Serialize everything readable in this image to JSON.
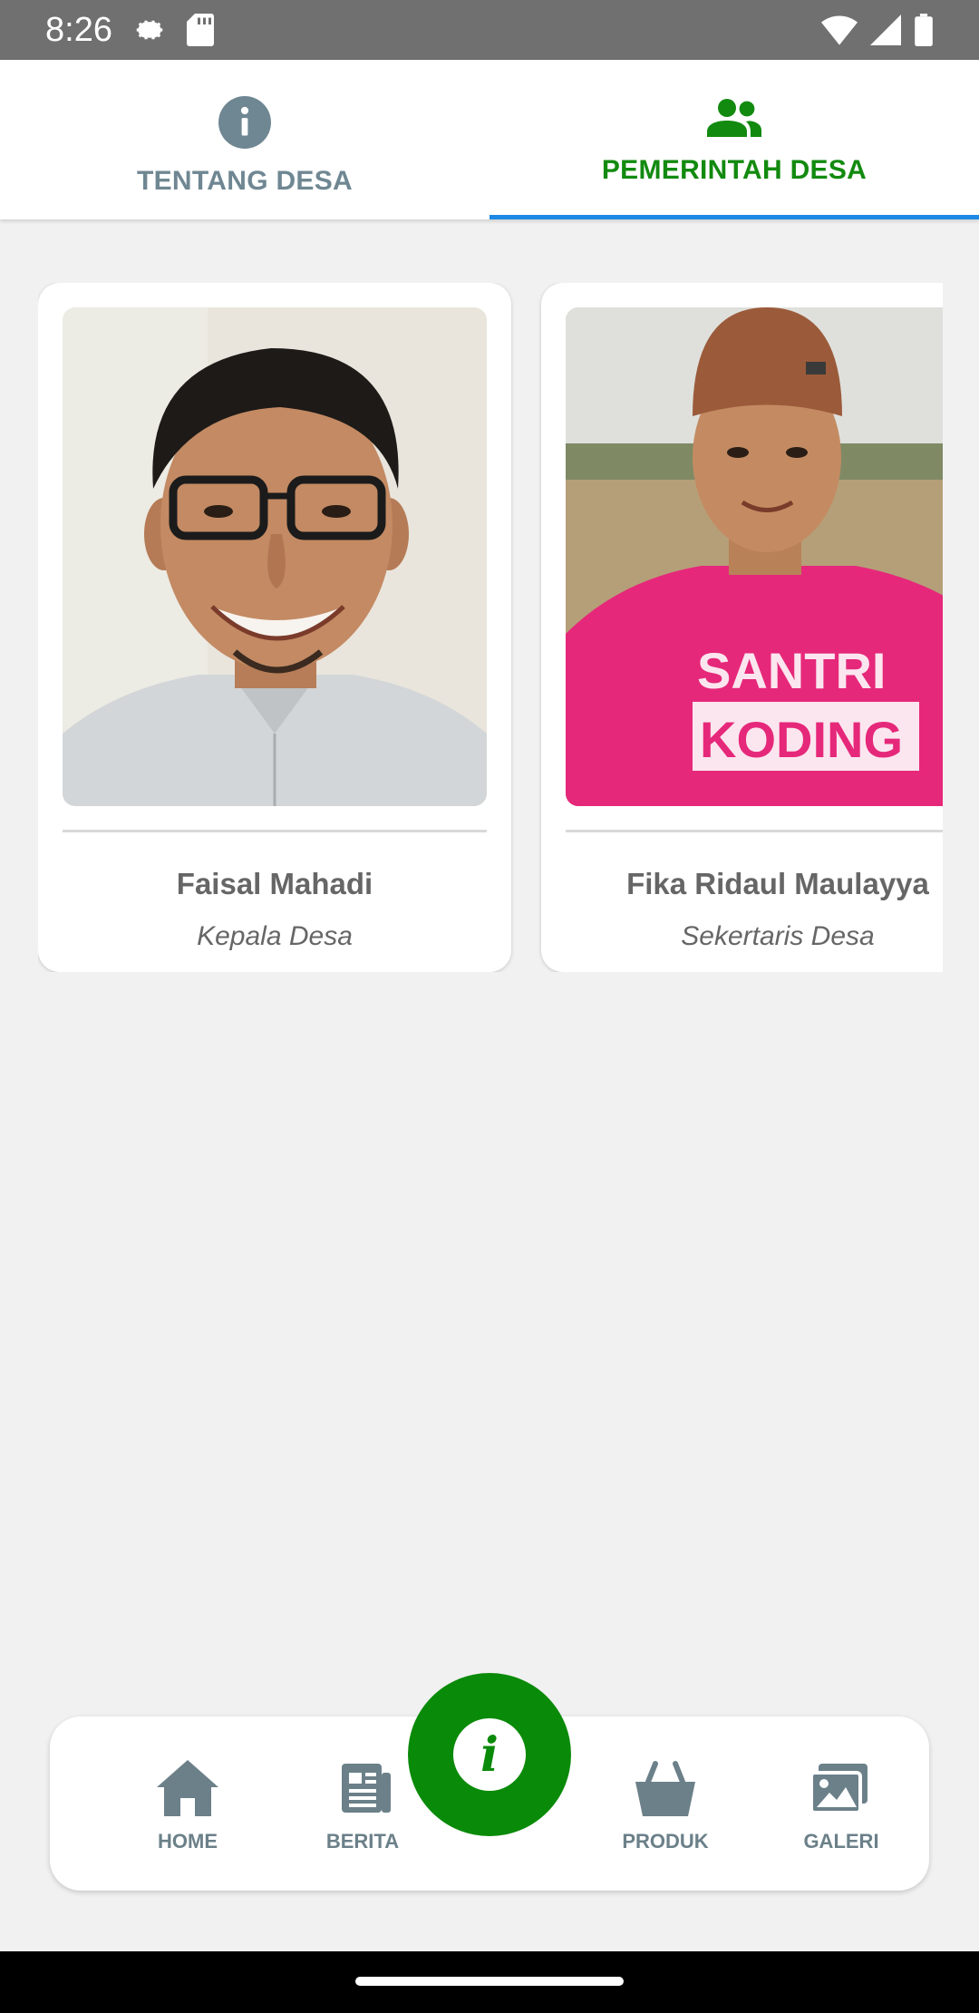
{
  "status_bar": {
    "time": "8:26",
    "icons_left": [
      "settings-icon",
      "sd-card-icon"
    ],
    "icons_right": [
      "wifi-icon",
      "signal-icon",
      "battery-icon"
    ]
  },
  "tabs": [
    {
      "label": "TENTANG DESA",
      "icon": "info-icon",
      "active": false
    },
    {
      "label": "PEMERINTAH DESA",
      "icon": "people-icon",
      "active": true
    }
  ],
  "officials": [
    {
      "name": "Faisal Mahadi",
      "role": "Kepala Desa",
      "photo": "portrait-man-glasses"
    },
    {
      "name": "Fika Ridaul Maulayya",
      "role": "Sekertaris Desa",
      "photo": "portrait-man-pink-shirt",
      "shirt_text_1": "SANTRI",
      "shirt_text_2": "KODING"
    }
  ],
  "bottom_nav": {
    "items": [
      {
        "label": "HOME",
        "icon": "home-icon"
      },
      {
        "label": "BERITA",
        "icon": "newspaper-icon"
      },
      {
        "label": "PRODUK",
        "icon": "basket-icon"
      },
      {
        "label": "GALERI",
        "icon": "gallery-icon"
      }
    ],
    "fab_icon": "info-icon",
    "fab_glyph": "i"
  },
  "colors": {
    "accent_green": "#128a0f",
    "tab_indicator": "#1e88e5",
    "inactive_gray": "#6f8792",
    "status_bar": "#707070"
  }
}
